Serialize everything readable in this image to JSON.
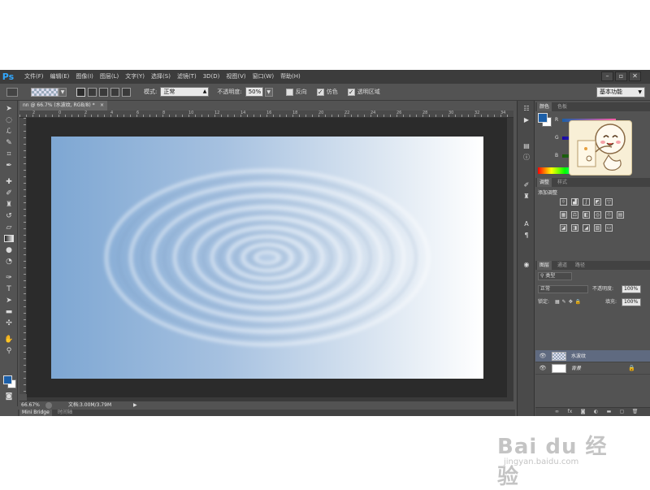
{
  "app": {
    "logo": "Ps",
    "menu": [
      "文件(F)",
      "编辑(E)",
      "图像(I)",
      "图层(L)",
      "文字(Y)",
      "选择(S)",
      "滤镜(T)",
      "3D(D)",
      "视图(V)",
      "窗口(W)",
      "帮助(H)"
    ],
    "window_controls": [
      "–",
      "▫",
      "✕"
    ]
  },
  "options": {
    "mode_label": "模式:",
    "mode_value": "正常",
    "opacity_label": "不透明度:",
    "opacity_value": "50%",
    "reverse_label": "反向",
    "reverse_checked": false,
    "dither_label": "仿色",
    "dither_checked": true,
    "transparency_label": "透明区域",
    "transparency_checked": true,
    "workspace": "基本功能"
  },
  "document": {
    "tab_title": "nn @ 66.7% (水波纹, RGB/8) *",
    "ruler_marks": [
      "2",
      "0",
      "2",
      "4",
      "6",
      "8",
      "10",
      "12",
      "14",
      "16",
      "18",
      "20",
      "22",
      "24",
      "26",
      "28",
      "30",
      "32",
      "34"
    ],
    "zoom": "66.67%",
    "doc_size": "文档:3.00M/3.79M"
  },
  "bottom_tabs": [
    "Mini Bridge",
    "时间轴"
  ],
  "panels": {
    "color_tabs": [
      "颜色",
      "色板"
    ],
    "channels": [
      "R",
      "G",
      "B"
    ],
    "adjust_tabs": [
      "调整",
      "样式"
    ],
    "adjust_title": "添加调整",
    "layer_tabs": [
      "图层",
      "通道",
      "路径"
    ],
    "filter_kind": "类型",
    "blend_mode": "正常",
    "opacity_label": "不透明度:",
    "opacity_value": "100%",
    "lock_label": "锁定:",
    "fill_label": "填充:",
    "fill_value": "100%",
    "layers": [
      {
        "name": "水波纹",
        "selected": true
      },
      {
        "name": "背景",
        "selected": false
      }
    ]
  },
  "colors": {
    "foreground": "#1c5fa8",
    "background": "#ffffff",
    "app_bg": "#535353",
    "menubar_bg": "#3c3c3c",
    "gradient_start": "#7ea7d3",
    "gradient_end": "#ffffff"
  },
  "watermark": {
    "main": "Bai du 经验",
    "sub": "jingyan.baidu.com"
  }
}
